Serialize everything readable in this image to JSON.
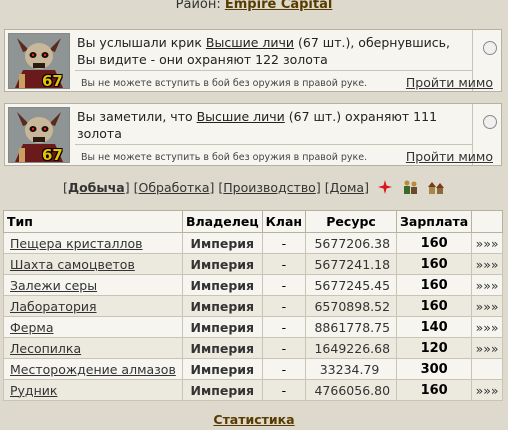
{
  "header": {
    "region_label": "Район:",
    "region_name": "Empire Capital"
  },
  "encounters": [
    {
      "level": "67",
      "text_before": "Вы услышали крик ",
      "creature": "Высшие личи",
      "text_after": " (67 шт.), обернувшись, Вы видите - они охраняют 122 золота",
      "warning": "Вы не можете вступить в бой без оружия в правой руке.",
      "action": "Пройти мимо"
    },
    {
      "level": "67",
      "text_before": "Вы заметили, что ",
      "creature": "Высшие личи",
      "text_after": " (67 шт.) охраняют 111 золота",
      "warning": "Вы не можете вступить в бой без оружия в правой руке.",
      "action": "Пройти мимо"
    }
  ],
  "tabs": [
    "Добыча",
    "Обработка",
    "Производство",
    "Дома"
  ],
  "icons": [
    "red-cross-icon",
    "workers-icon",
    "buildings-icon"
  ],
  "table": {
    "headers": [
      "Тип",
      "Владелец",
      "Клан",
      "Ресурс",
      "Зарплата",
      ""
    ],
    "rows": [
      {
        "name": "Пещера кристаллов",
        "owner": "Империя",
        "clan": "-",
        "resource": "5677206.38",
        "pay": "160",
        "more": "»»»"
      },
      {
        "name": "Шахта самоцветов",
        "owner": "Империя",
        "clan": "-",
        "resource": "5677241.18",
        "pay": "160",
        "more": "»»»"
      },
      {
        "name": "Залежи серы",
        "owner": "Империя",
        "clan": "-",
        "resource": "5677245.45",
        "pay": "160",
        "more": "»»»"
      },
      {
        "name": "Лаборатория",
        "owner": "Империя",
        "clan": "-",
        "resource": "6570898.52",
        "pay": "160",
        "more": "»»»"
      },
      {
        "name": "Ферма",
        "owner": "Империя",
        "clan": "-",
        "resource": "8861778.75",
        "pay": "140",
        "more": "»»»"
      },
      {
        "name": "Лесопилка",
        "owner": "Империя",
        "clan": "-",
        "resource": "1649226.68",
        "pay": "120",
        "more": "»»»"
      },
      {
        "name": "Месторождение алмазов",
        "owner": "Империя",
        "clan": "-",
        "resource": "33234.79",
        "pay": "300",
        "more": ""
      },
      {
        "name": "Рудник",
        "owner": "Империя",
        "clan": "-",
        "resource": "4766056.80",
        "pay": "160",
        "more": "»»»"
      }
    ]
  },
  "footer": {
    "stats_link": "Статистика"
  }
}
